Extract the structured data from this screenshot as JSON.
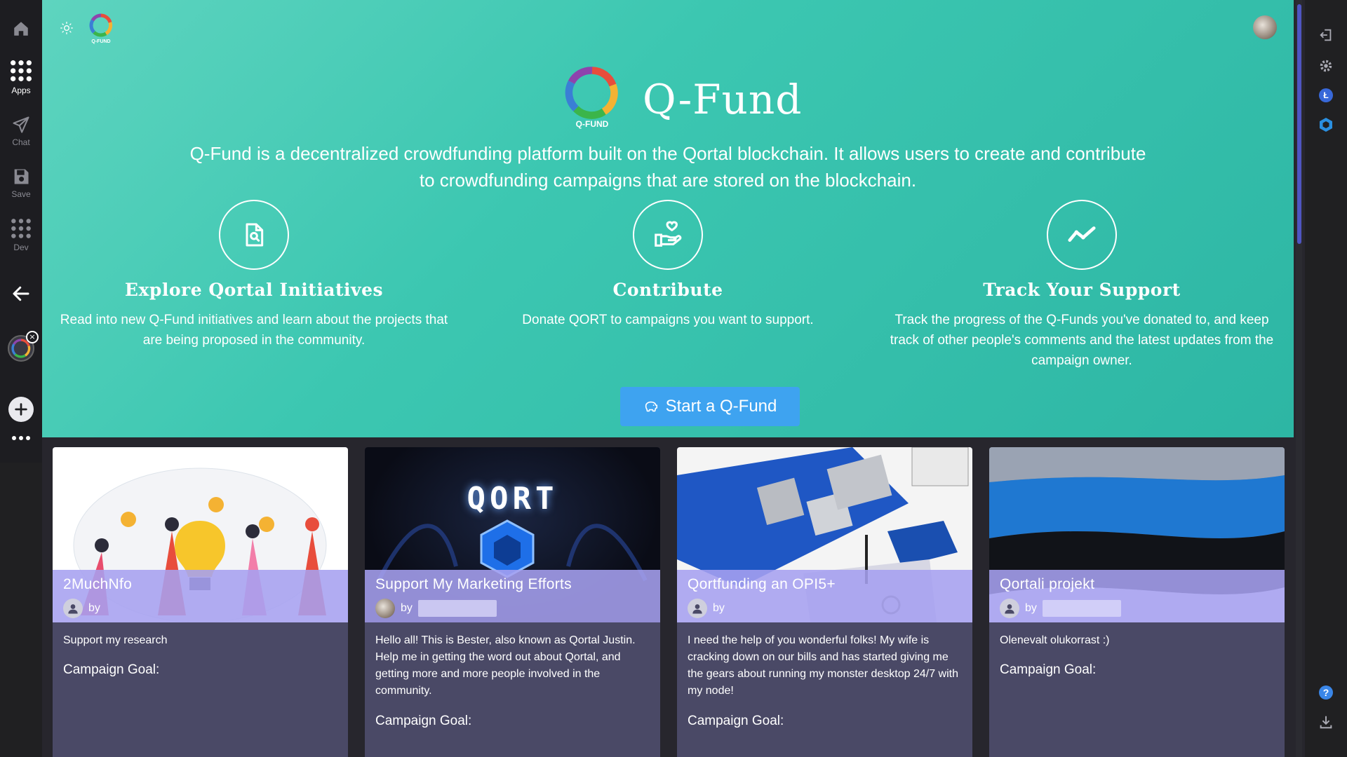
{
  "left_sidebar": {
    "items": [
      {
        "label": ""
      },
      {
        "label": "Apps"
      },
      {
        "label": "Chat"
      },
      {
        "label": "Save"
      },
      {
        "label": "Dev"
      }
    ]
  },
  "app": {
    "logo_caption_small": "Q-FUND",
    "logo_caption": "Q-FUND",
    "title": "Q-Fund",
    "intro": "Q-Fund is a decentralized crowdfunding platform built on the Qortal blockchain. It allows users to create and contribute to crowdfunding campaigns that are stored on the blockchain."
  },
  "features": [
    {
      "title": "Explore Qortal Initiatives",
      "desc": "Read into new Q-Fund initiatives and learn about the projects that are being proposed in the community.",
      "icon": "document-search-icon"
    },
    {
      "title": "Contribute",
      "desc": "Donate QORT to campaigns you want to support.",
      "icon": "heart-hand-icon"
    },
    {
      "title": "Track Your Support",
      "desc": "Track the progress of the Q-Funds you've donated to, and keep track of other people's comments and the latest updates from the campaign owner.",
      "icon": "trend-line-icon"
    }
  ],
  "start_button": {
    "label": "Start a Q-Fund"
  },
  "cards": [
    {
      "title": "2MuchNfo",
      "by": "by",
      "desc": "Support my research",
      "goal_label": "Campaign Goal:"
    },
    {
      "title": "Support My Marketing Efforts",
      "by": "by",
      "desc": "Hello all! This is Bester, also known as Qortal Justin. Help me in getting the word out about Qortal, and getting more and more people involved in the community.",
      "goal_label": "Campaign Goal:",
      "image_text": "QORT"
    },
    {
      "title": "Qortfunding an OPI5+",
      "by": "by",
      "desc": "I need the help of you wonderful folks! My wife is cracking down on our bills and has started giving me the gears about running my monster desktop 24/7 with my node!",
      "goal_label": "Campaign Goal:"
    },
    {
      "title": "Qortali projekt",
      "by": "by",
      "desc": "Olenevalt olukorrast :)",
      "goal_label": "Campaign Goal:"
    }
  ],
  "colors": {
    "hero": "#3cc7b1",
    "button": "#3ea3f0",
    "card_bg": "#4a4966",
    "card_overlay": "#a6a0f0"
  }
}
